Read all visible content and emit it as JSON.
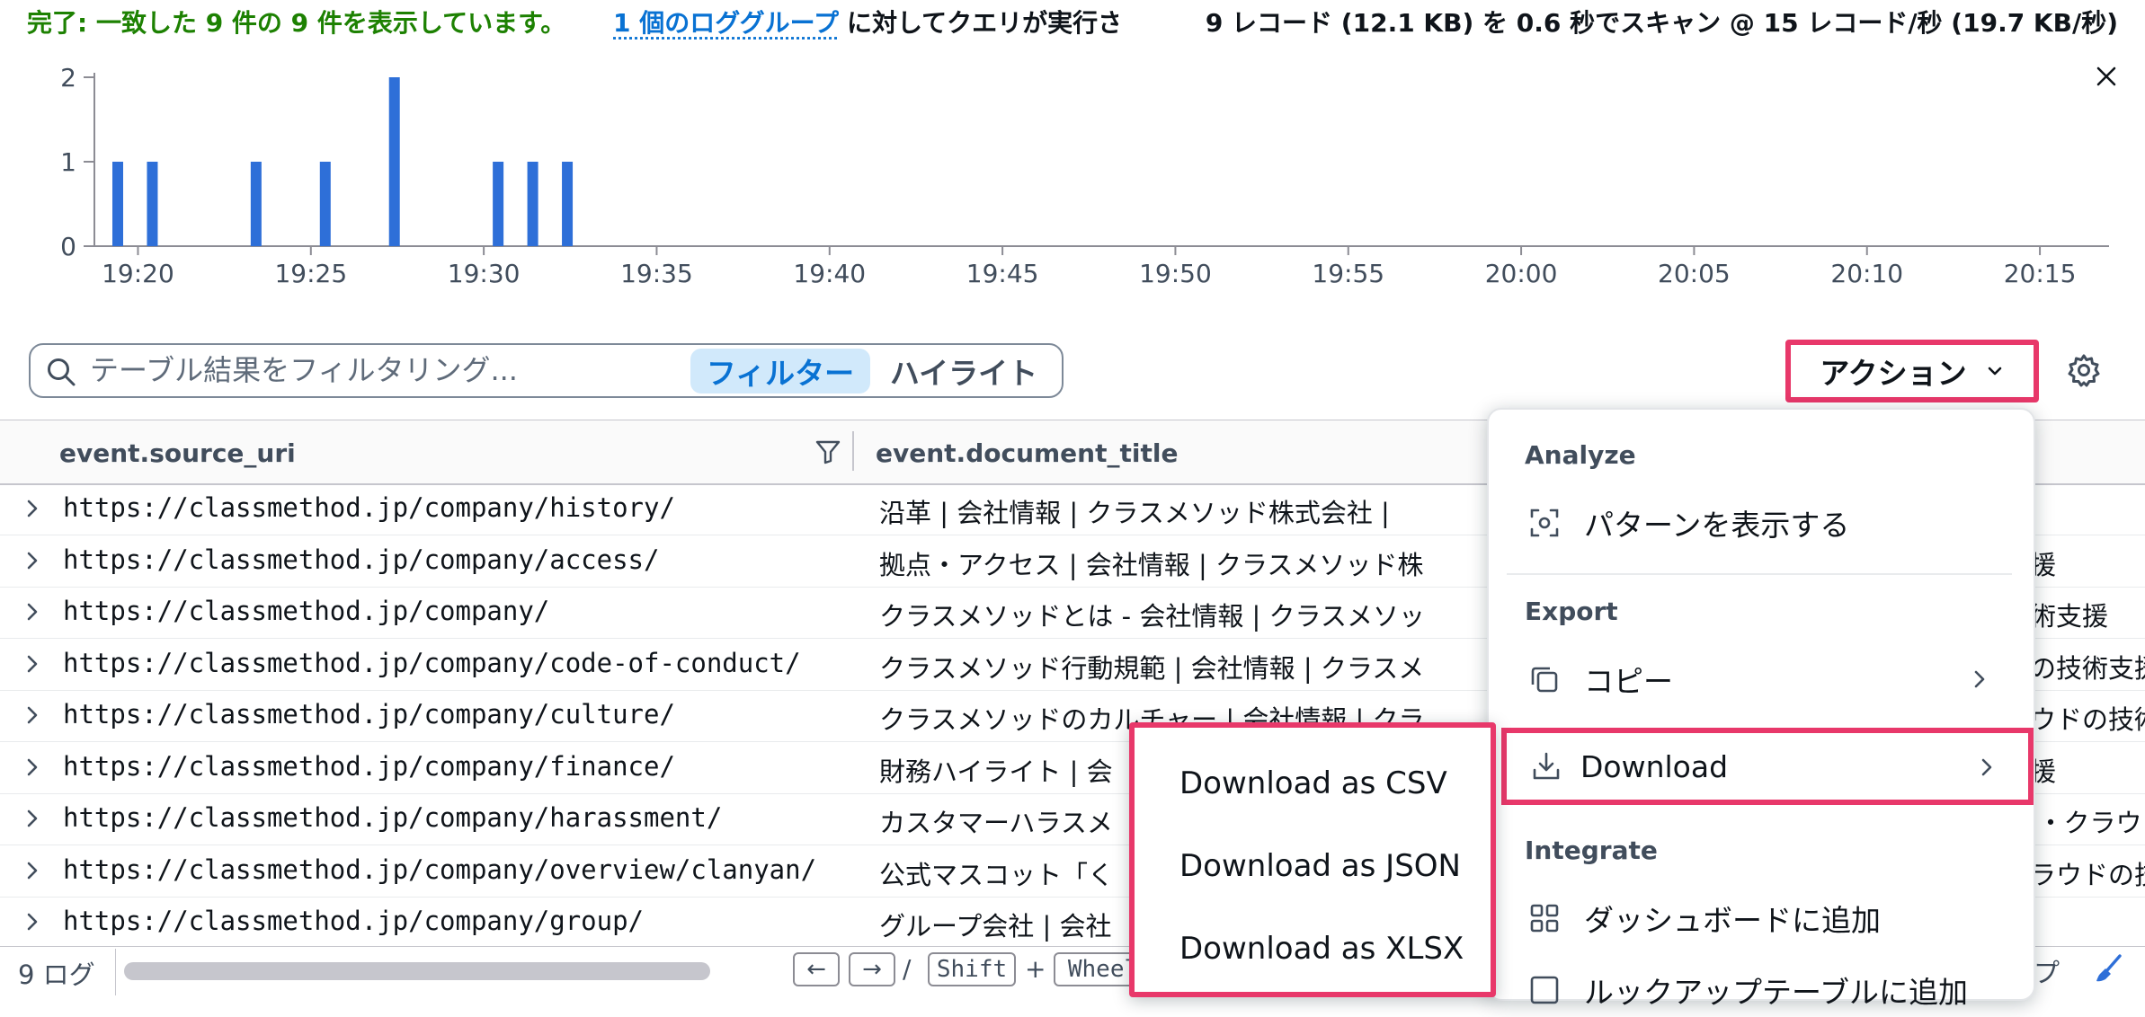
{
  "status": {
    "left": "完了: 一致した 9 件の 9 件を表示しています。",
    "link": "1 個のロググループ",
    "link_rest": "に対してクエリが実行されました",
    "right": "9 レコード (12.1 KB) を 0.6 秒でスキャン @ 15 レコード/秒 (19.7 KB/秒)"
  },
  "chart_data": {
    "type": "bar",
    "title": "",
    "xlabel": "",
    "ylabel": "",
    "ylim": [
      0,
      2
    ],
    "yticks": [
      0,
      1,
      2
    ],
    "xlim": [
      "19:19",
      "20:17"
    ],
    "xticks": [
      "19:20",
      "19:25",
      "19:30",
      "19:35",
      "19:40",
      "19:45",
      "19:50",
      "19:55",
      "20:00",
      "20:05",
      "20:10",
      "20:15"
    ],
    "bars": [
      {
        "time": "19:19",
        "count": 1
      },
      {
        "time": "19:20",
        "count": 1
      },
      {
        "time": "19:23",
        "count": 1
      },
      {
        "time": "19:25",
        "count": 1
      },
      {
        "time": "19:27",
        "count": 2
      },
      {
        "time": "19:30",
        "count": 1
      },
      {
        "time": "19:31",
        "count": 1
      },
      {
        "time": "19:32",
        "count": 1
      }
    ],
    "color": "#2e6fd8",
    "grid": false
  },
  "filter": {
    "placeholder": "テーブル結果をフィルタリング...",
    "mode_filter": "フィルター",
    "mode_highlight": "ハイライト"
  },
  "actions": {
    "label": "アクション"
  },
  "table": {
    "columns": [
      "event.source_uri",
      "event.document_title"
    ],
    "rows": [
      {
        "uri": "https://classmethod.jp/company/history/",
        "title": "沿革 | 会社情報 | クラスメソッド株式会社 |",
        "tail": ""
      },
      {
        "uri": "https://classmethod.jp/company/access/",
        "title": "拠点・アクセス | 会社情報 | クラスメソッド株",
        "tail": "援"
      },
      {
        "uri": "https://classmethod.jp/company/",
        "title": "クラスメソッドとは - 会社情報 | クラスメソッ",
        "tail": "術支援"
      },
      {
        "uri": "https://classmethod.jp/company/code-of-conduct/",
        "title": "クラスメソッド行動規範 | 会社情報 | クラスメ",
        "tail": "の技術支援"
      },
      {
        "uri": "https://classmethod.jp/company/culture/",
        "title": "クラスメソッドのカルチャー | 会社情報 | クラ",
        "tail": "ウドの技術"
      },
      {
        "uri": "https://classmethod.jp/company/finance/",
        "title": "財務ハイライト | 会",
        "tail": "援"
      },
      {
        "uri": "https://classmethod.jp/company/harassment/",
        "title": "カスタマーハラスメ",
        "tail": "I・クラウ"
      },
      {
        "uri": "https://classmethod.jp/company/overview/clanyan/",
        "title": "公式マスコット「く",
        "tail": "ラウドの技"
      },
      {
        "uri": "https://classmethod.jp/company/group/",
        "title": "グループ会社 | 会社",
        "tail": ""
      }
    ]
  },
  "footer": {
    "log_count": "9 ログ",
    "keys": [
      "←",
      "→",
      "/",
      "Shift",
      "+",
      "Wheel"
    ],
    "tail": "プ"
  },
  "menu": {
    "analyze_group": "Analyze",
    "show_patterns": "パターンを表示する",
    "export_group": "Export",
    "copy": "コピー",
    "download": "Download",
    "integrate_group": "Integrate",
    "add_dashboard": "ダッシュボードに追加",
    "add_lookup": "ルックアップテーブルに追加"
  },
  "submenu": {
    "csv": "Download as CSV",
    "json": "Download as JSON",
    "xlsx": "Download as XLSX"
  },
  "icons": [
    "search-icon",
    "close-icon",
    "settings-icon",
    "filter-icon",
    "chevron-right-icon",
    "chevron-down-icon",
    "patterns-icon",
    "copy-icon",
    "download-icon",
    "dashboard-icon",
    "brush-icon"
  ]
}
